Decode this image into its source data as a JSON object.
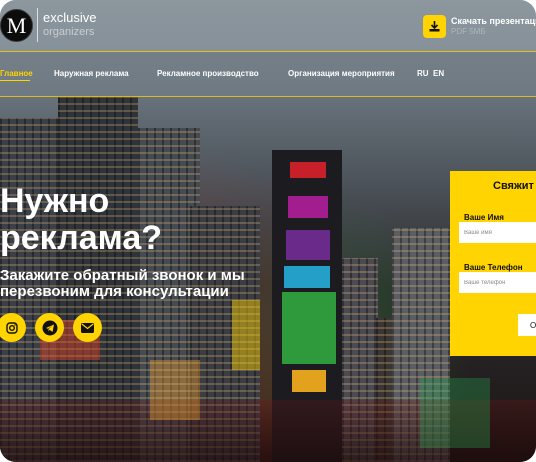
{
  "brand": {
    "logo_letter": "M",
    "name": "exclusive",
    "tagline": "organizers"
  },
  "download": {
    "label": "Скачать презентаци",
    "sub": "PDF 5МБ"
  },
  "nav": {
    "items": [
      {
        "label": "Главное",
        "active": true
      },
      {
        "label": "Наружная реклама",
        "active": false
      },
      {
        "label": "Рекламное производство",
        "active": false
      },
      {
        "label": "Организация мероприятия",
        "active": false
      }
    ],
    "langs": [
      "RU",
      "EN"
    ]
  },
  "hero": {
    "title_line1": "Нужно",
    "title_line2": "реклама?",
    "subtitle_line1": "Закажите обратный звонок и мы",
    "subtitle_line2": "перезвоним для консультации"
  },
  "social": [
    {
      "icon": "instagram-icon"
    },
    {
      "icon": "telegram-icon"
    },
    {
      "icon": "email-icon"
    }
  ],
  "form": {
    "title": "Свяжит",
    "name_label": "Ваше Имя",
    "name_placeholder": "Ваше имя",
    "phone_label": "Ваше Телефон",
    "phone_placeholder": "Ваше телефон",
    "submit_label": "О"
  },
  "colors": {
    "accent": "#ffd400",
    "text": "#ffffff"
  }
}
